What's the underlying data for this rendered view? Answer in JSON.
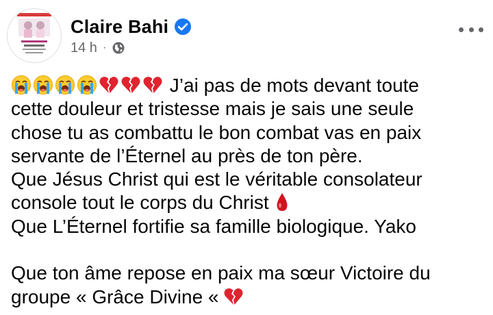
{
  "post": {
    "author": "Claire Bahi",
    "time": "14 h",
    "separator": "·",
    "audience_icon": "globe-icon",
    "verified_icon": "verified-badge-icon",
    "more_icon": "more-options-icon",
    "avatar_icon": "profile-picture",
    "colors": {
      "verified": "#1877f2",
      "meta": "#65676b",
      "text": "#050505"
    },
    "body": {
      "line1": "J’ai pas de mots devant toute",
      "line2": "cette douleur et tristesse mais je sais une seule",
      "line3": "chose tu as combattu le bon combat vas en paix",
      "line4": "servante de l’Éternel au près de ton père.",
      "line5": "Que Jésus Christ qui est le véritable consolateur",
      "line6": "console tout le corps du Christ",
      "line7": "Que L’Éternel fortifie sa famille biologique. Yako",
      "line8": "Que ton âme repose en paix ma sœur Victoire du",
      "line9": "groupe « Grâce Divine «"
    },
    "emojis": {
      "crying": "loudly-crying-face-icon",
      "broken_heart": "broken-heart-icon",
      "drop": "drop-of-blood-icon"
    }
  }
}
